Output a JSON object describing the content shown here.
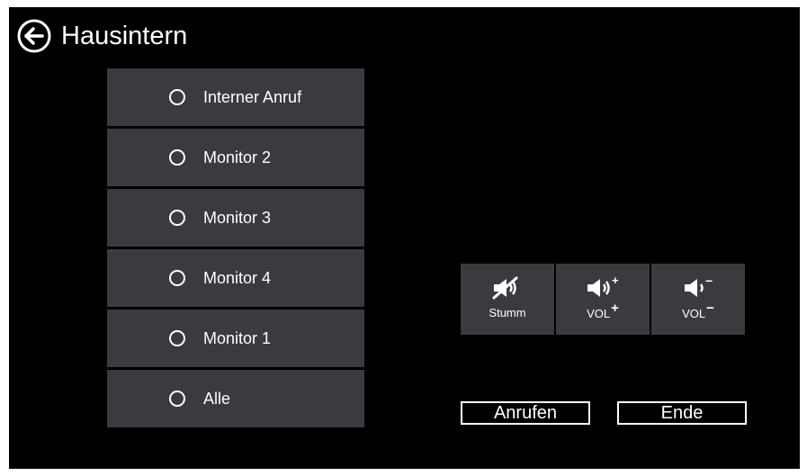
{
  "header": {
    "title": "Hausintern",
    "back_icon": "arrow-left-circle-icon"
  },
  "list": {
    "items": [
      {
        "label": "Interner Anruf",
        "selected": false
      },
      {
        "label": "Monitor 2",
        "selected": false
      },
      {
        "label": "Monitor 3",
        "selected": false
      },
      {
        "label": "Monitor 4",
        "selected": false
      },
      {
        "label": "Monitor 1",
        "selected": false
      },
      {
        "label": "Alle",
        "selected": false
      }
    ]
  },
  "controls": {
    "mute": {
      "label": "Stumm",
      "icon": "speaker-muted-icon"
    },
    "vol_up": {
      "label": "VOL",
      "sup": "+",
      "icon": "speaker-volume-up-icon",
      "icon_sup": "+"
    },
    "vol_down": {
      "label": "VOL",
      "sup": "−",
      "icon": "speaker-volume-down-icon",
      "icon_sup": "−"
    }
  },
  "actions": {
    "call_label": "Anrufen",
    "end_label": "Ende"
  },
  "colors": {
    "background": "#000000",
    "panel": "#3b3b3f",
    "text": "#ffffff"
  }
}
